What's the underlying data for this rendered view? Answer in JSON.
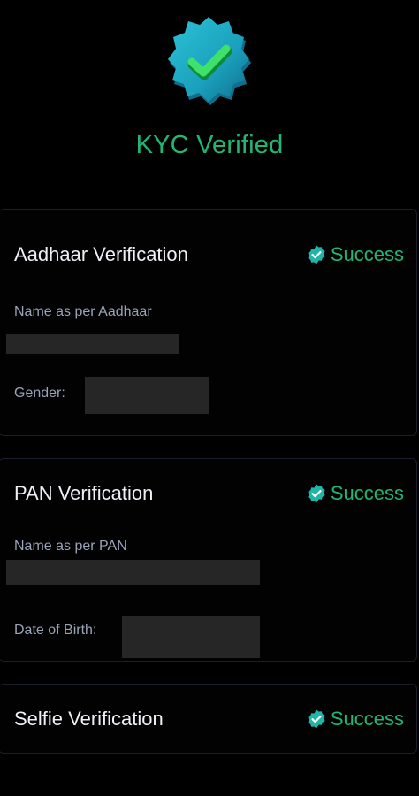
{
  "header": {
    "title": "KYC Verified",
    "badge_icon": "verified-badge-icon",
    "accent_color": "#22b573"
  },
  "cards": [
    {
      "title": "Aadhaar Verification",
      "status": "Success",
      "fields": [
        {
          "label": "Name as per Aadhaar",
          "value": ""
        },
        {
          "label": "Gender:",
          "value": ""
        }
      ]
    },
    {
      "title": "PAN Verification",
      "status": "Success",
      "fields": [
        {
          "label": "Name as per PAN",
          "value": ""
        },
        {
          "label": "Date of Birth:",
          "value": ""
        }
      ]
    },
    {
      "title": "Selfie Verification",
      "status": "Success"
    }
  ]
}
